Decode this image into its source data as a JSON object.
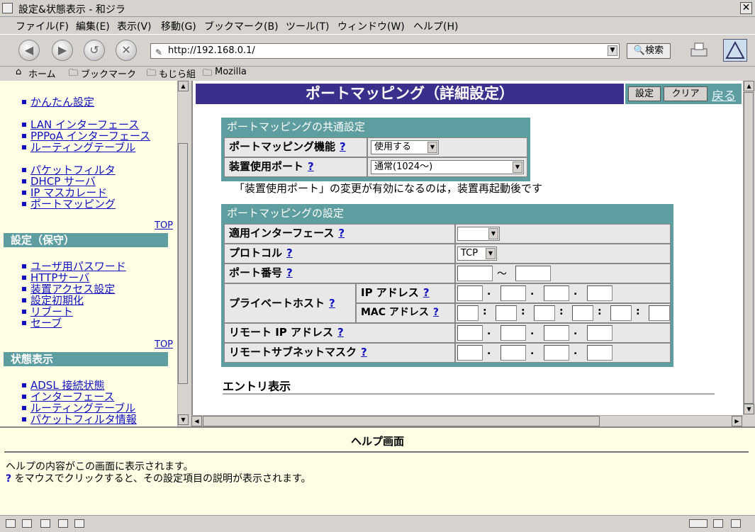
{
  "window": {
    "title": "設定&状態表示 - 和ジラ",
    "close_glyph": "✕"
  },
  "menu": [
    "ファイル(F)",
    "編集(E)",
    "表示(V)",
    "移動(G)",
    "ブックマーク(B)",
    "ツール(T)",
    "ウィンドウ(W)",
    "ヘルプ(H)"
  ],
  "toolbar": {
    "url": "http://192.168.0.1/",
    "search_label": "🔍検索"
  },
  "bookmarks": [
    "ホーム",
    "ブックマーク",
    "もじら組",
    "Mozilla"
  ],
  "sidebar": {
    "easy": "かんたん設定",
    "group1": [
      "LAN インターフェース",
      "PPPoA インターフェース",
      "ルーティングテーブル"
    ],
    "group2": [
      "パケットフィルタ",
      "DHCP サーバ",
      "IP マスカレード",
      "ポートマッピング"
    ],
    "top1": "TOP",
    "section_maintenance": "設定（保守）",
    "group3": [
      "ユーザ用パスワード",
      "HTTPサーバ",
      "装置アクセス設定",
      "設定初期化",
      "リブート",
      "セーブ"
    ],
    "top2": "TOP",
    "section_status": "状態表示",
    "group4": [
      "ADSL 接続状態",
      "インターフェース",
      "ルーティングテーブル",
      "パケットフィルタ情報"
    ]
  },
  "main": {
    "title": "ポートマッピング（詳細設定）",
    "btn_set": "設定",
    "btn_clear": "クリア",
    "btn_back": "戻る",
    "common": {
      "title": "ポートマッピングの共通設定",
      "func_label": "ポートマッピング機能",
      "func_value": "使用する",
      "port_label": "装置使用ポート",
      "port_value": "通常(1024～)",
      "q": "?"
    },
    "note": "「装置使用ポート」の変更が有効になるのは，装置再起動後です",
    "mapping": {
      "title": "ポートマッピングの設定",
      "iface_label": "適用インターフェース",
      "iface_value": "",
      "proto_label": "プロトコル",
      "proto_value": "TCP",
      "port_label": "ポート番号",
      "tilde": "～",
      "private_label": "プライベートホスト",
      "ip_label": "IP アドレス",
      "mac_label": "MAC アドレス",
      "remote_ip_label": "リモート IP アドレス",
      "remote_mask_label": "リモートサブネットマスク",
      "dot": ".",
      "colon": ":"
    },
    "entry": "エントリ表示"
  },
  "help": {
    "title": "ヘルプ画面",
    "line1": "ヘルプの内容がこの画面に表示されます。",
    "q": "?",
    "line2": " をマウスでクリックすると、その設定項目の説明が表示されます。"
  }
}
